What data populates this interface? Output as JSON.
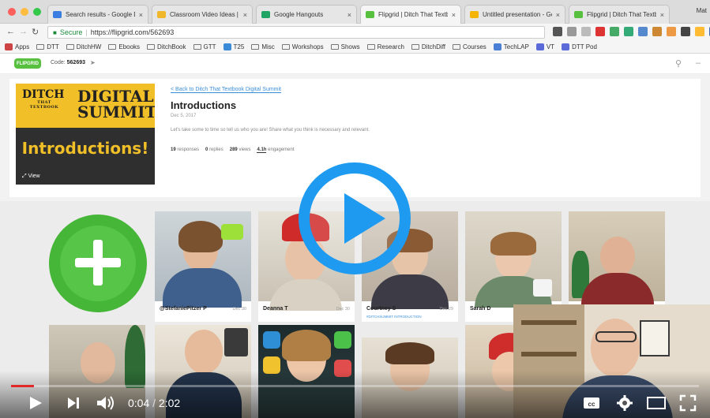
{
  "browser": {
    "tabs": [
      {
        "label": "Search results - Google Dri",
        "color": "#3b7de0"
      },
      {
        "label": "Classroom Video Ideas | Di",
        "color": "#f0b72a"
      },
      {
        "label": "Google Hangouts",
        "color": "#1fa463"
      },
      {
        "label": "Flipgrid | Ditch That Textbo",
        "color": "#57c13f"
      },
      {
        "label": "Untitled presentation - Goo",
        "color": "#f4b400"
      },
      {
        "label": "Flipgrid | Ditch That Textbo",
        "color": "#57c13f"
      }
    ],
    "profile": "Mat",
    "secure_label": "Secure",
    "url": "https://flipgrid.com/562693",
    "bookmarks": [
      "Apps",
      "DTT",
      "DitchHW",
      "Ebooks",
      "DitchBook",
      "GTT",
      "T25",
      "Misc",
      "Workshops",
      "Shows",
      "Research",
      "DitchDiff",
      "Courses",
      "TechLAP",
      "VT",
      "DTT Pod"
    ]
  },
  "flipgrid": {
    "logo": "FLIPGRID",
    "code_label": "Code:",
    "code": "562693",
    "back_link": "< Back to Ditch That Textbook Digital Summit",
    "topic_title": "Introductions",
    "topic_date": "Dec 5, 2017",
    "topic_desc": "Let's take some to time so tell us who you are! Share what you think is necessary and relevant.",
    "thumb": {
      "ditch": "DITCH",
      "that": "THAT",
      "textbook": "TEXTBOOK",
      "digital": "DIGITAL",
      "summit": "SUMMIT",
      "introductions": "Introductions!",
      "view": "View"
    },
    "stats": {
      "responses": "19",
      "responses_label": "responses",
      "replies": "0",
      "replies_label": "replies",
      "views": "289",
      "views_label": "views",
      "engagement": "4.1h",
      "engagement_label": "engagement"
    },
    "responses": [
      {
        "name": "@StefaniePitzer P",
        "date": "Dec 30",
        "tag": ""
      },
      {
        "name": "Deanna T",
        "date": "Dec 30",
        "tag": ""
      },
      {
        "name": "Courtney S",
        "date": "Dec 29",
        "tag": "#DITCHSUMMIT INTRODUCTION"
      },
      {
        "name": "Sarah D",
        "date": "",
        "tag": ""
      }
    ]
  },
  "player": {
    "time_current": "0:04",
    "time_total": "2:02",
    "progress": 0.033,
    "accent": "#1e9bf0"
  }
}
